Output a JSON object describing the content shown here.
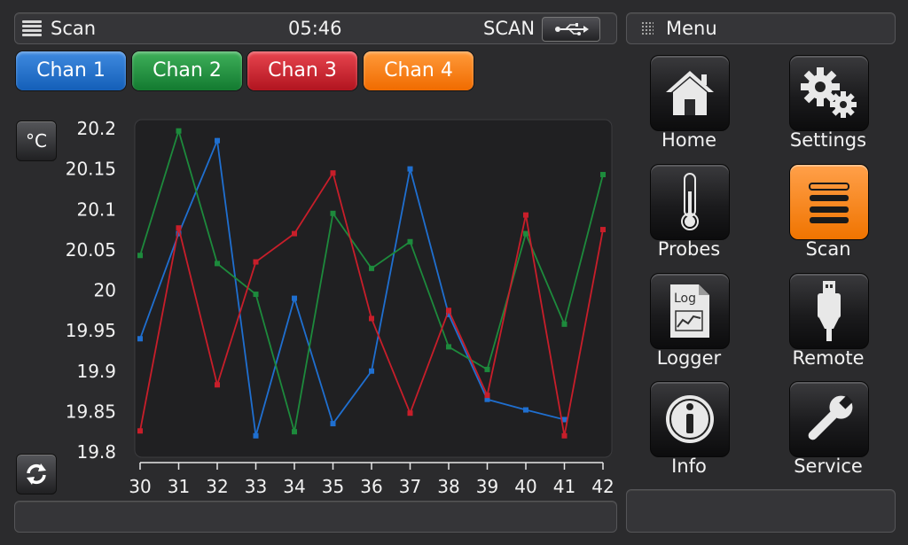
{
  "header": {
    "title": "Scan",
    "time": "05:46",
    "mode": "SCAN"
  },
  "menu": {
    "title": "Menu"
  },
  "channels": [
    {
      "label": "Chan 1",
      "color": "#1f6fd0"
    },
    {
      "label": "Chan 2",
      "color": "#1d8a3c"
    },
    {
      "label": "Chan 3",
      "color": "#c81e2a"
    },
    {
      "label": "Chan 4",
      "color": "#f47a10"
    }
  ],
  "unit_button": "°C",
  "nav": [
    {
      "label": "Home",
      "icon": "house-icon"
    },
    {
      "label": "Settings",
      "icon": "gears-icon"
    },
    {
      "label": "Probes",
      "icon": "thermometer-icon"
    },
    {
      "label": "Scan",
      "icon": "list-icon",
      "active": true
    },
    {
      "label": "Logger",
      "icon": "log-document-icon"
    },
    {
      "label": "Remote",
      "icon": "usb-plug-icon"
    },
    {
      "label": "Info",
      "icon": "info-icon"
    },
    {
      "label": "Service",
      "icon": "wrench-icon"
    }
  ],
  "chart_data": {
    "type": "line",
    "x": [
      30,
      31,
      32,
      33,
      34,
      35,
      36,
      37,
      38,
      39,
      40,
      41,
      42
    ],
    "ylim": [
      19.8,
      20.2
    ],
    "yticks": [
      "20.2",
      "20.15",
      "20.1",
      "20.05",
      "20",
      "19.95",
      "19.9",
      "19.85",
      "19.8"
    ],
    "xticks": [
      "30",
      "31",
      "32",
      "33",
      "34",
      "35",
      "36",
      "37",
      "38",
      "39",
      "40",
      "41",
      "42"
    ],
    "series": [
      {
        "color": "#1f6fd0",
        "x": [
          30,
          31,
          32,
          33,
          34,
          35,
          36,
          37,
          38,
          39,
          40,
          41
        ],
        "values": [
          19.94,
          20.07,
          20.185,
          19.82,
          19.99,
          19.835,
          19.9,
          20.15,
          19.97,
          19.865,
          19.852,
          19.84
        ]
      },
      {
        "color": "#1d8a3c",
        "x": [
          30,
          31,
          32,
          33,
          34,
          35,
          36,
          37,
          38,
          39,
          40,
          41,
          42
        ],
        "values": [
          20.043,
          20.197,
          20.033,
          19.995,
          19.825,
          20.095,
          20.027,
          20.06,
          19.93,
          19.902,
          20.07,
          19.958,
          20.143
        ]
      },
      {
        "color": "#c81e2a",
        "x": [
          30,
          31,
          32,
          33,
          34,
          35,
          36,
          37,
          38,
          39,
          40,
          41,
          42
        ],
        "values": [
          19.826,
          20.077,
          19.883,
          20.035,
          20.07,
          20.145,
          19.965,
          19.848,
          19.975,
          19.87,
          20.093,
          19.82,
          20.075
        ]
      }
    ]
  }
}
